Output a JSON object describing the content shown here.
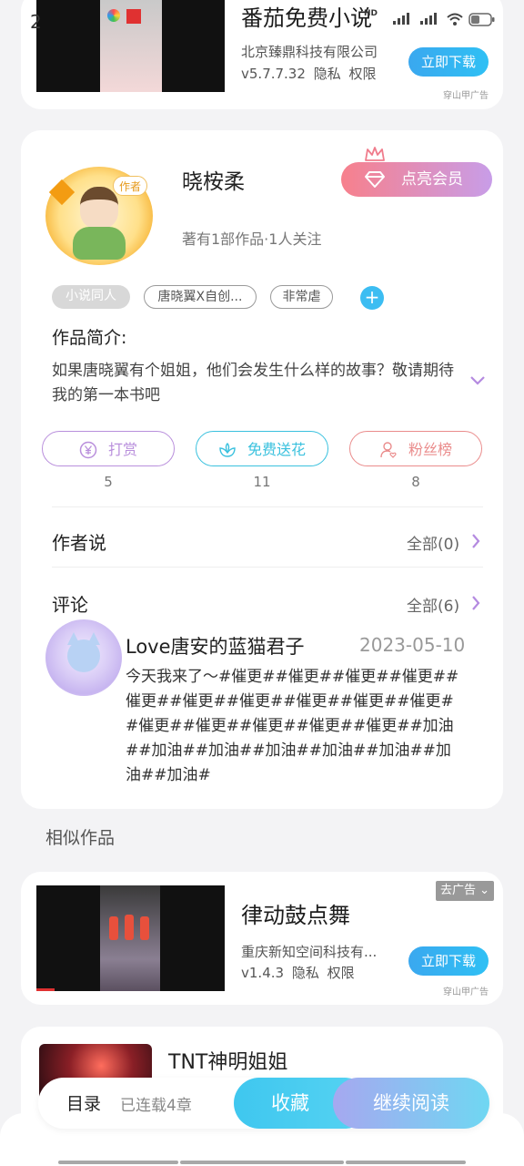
{
  "status_bar": {
    "time": "2"
  },
  "ad_top": {
    "title": "番茄免费小说",
    "company": "北京臻鼎科技有限公司",
    "version": "v5.7.7.32",
    "privacy": "隐私",
    "permissions": "权限",
    "download": "立即下载",
    "source": "穿山甲广告"
  },
  "author": {
    "avatar_tag": "作者",
    "name": "晓桉柔",
    "stats": "著有1部作品·1人关注",
    "vip_button": "点亮会员",
    "tags": [
      "小说同人",
      "唐晓翼X自创...",
      "非常虐"
    ],
    "intro_title": "作品简介:",
    "intro_text": "如果唐晓翼有个姐姐，他们会发生什么样的故事？敬请期待我的第一本书吧",
    "actions": [
      {
        "label": "打赏",
        "count": "5",
        "color": "#b98fdc"
      },
      {
        "label": "免费送花",
        "count": "11",
        "color": "#3ac1de"
      },
      {
        "label": "粉丝榜",
        "count": "8",
        "color": "#ea8c8c"
      }
    ]
  },
  "author_says": {
    "title": "作者说",
    "more": "全部(0)"
  },
  "comments": {
    "title": "评论",
    "more": "全部(6)",
    "items": [
      {
        "user": "Love唐安的蓝猫君子",
        "date": "2023-05-10",
        "text": "今天我来了～#催更##催更##催更##催更##催更##催更##催更##催更##催更##催更##催更##催更##催更##催更##催更##加油##加油##加油##加油##加油##加油##加油##加油#"
      }
    ]
  },
  "similar": {
    "title": "相似作品"
  },
  "ad_similar": {
    "remove_ad": "去广告",
    "title": "律动鼓点舞",
    "company": "重庆新知空间科技有...",
    "version": "v1.4.3",
    "privacy": "隐私",
    "permissions": "权限",
    "download": "立即下载",
    "source": "穿山甲广告"
  },
  "book": {
    "title": "TNT神明姐姐"
  },
  "bottom_bar": {
    "toc": "目录",
    "chapters": "已连载4章",
    "favorite": "收藏",
    "continue": "继续阅读"
  }
}
